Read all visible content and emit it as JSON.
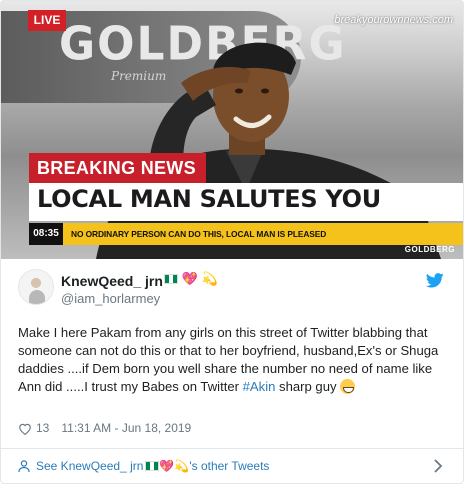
{
  "media": {
    "live_label": "LIVE",
    "watermark": "breakyourownnews.com",
    "background_logo": "GOLDBERG",
    "breaking_label": "BREAKING NEWS",
    "headline": "LOCAL MAN SALUTES YOU",
    "ticker_time": "08:35",
    "ticker_text": "NO ORDINARY PERSON CAN DO THIS, LOCAL MAN IS PLEASED",
    "corner_mark": "GOLDBERG",
    "colors": {
      "breaking_red": "#c8202a",
      "ticker_yellow": "#f4c21a",
      "live_red": "#d32027"
    }
  },
  "tweet": {
    "display_name": "KnewQeed_ jrn",
    "name_emojis": [
      "nigeria-flag",
      "sparkling-heart",
      "dizzy"
    ],
    "handle": "@iam_horlarmey",
    "text_main": "Make I here Pakam from any girls on this street of Twitter blabbing that someone can not do this or that to her boyfriend, husband,Ex's or Shuga daddies ....if Dem born you well share the number no need of name like Ann did  .....I trust my Babes on Twitter ",
    "hashtag": "#Akin",
    "text_tail": " sharp guy ",
    "likes": "13",
    "timestamp": "11:31 AM - Jun 18, 2019",
    "footer_prefix": "See KnewQeed_ jrn",
    "footer_suffix": "'s other Tweets",
    "accent": "#2b7bb9"
  }
}
